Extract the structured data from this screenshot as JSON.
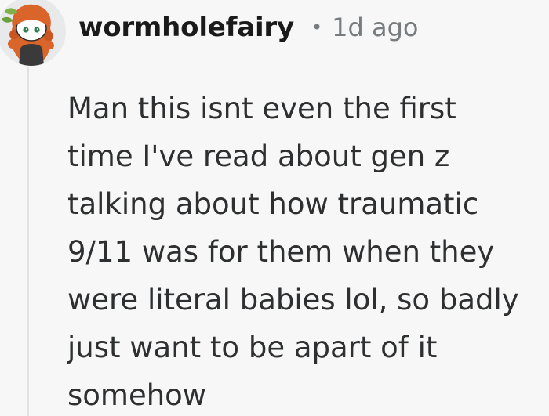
{
  "comment": {
    "author": "wormholefairy",
    "separator": "•",
    "timestamp": "1d ago",
    "avatar_icon": "snoo-avatar-icon",
    "body_lines": [
      "Man this isnt even the first",
      "time I've read about gen z",
      "talking about how traumatic",
      "9/11 was for them when they",
      "were literal babies lol, so badly",
      "just want to be apart of it",
      "somehow"
    ]
  },
  "colors": {
    "background": "#f7f7f7",
    "text": "#2e2f30",
    "meta": "#787c7e",
    "thread_line": "#e2e2e2",
    "avatar_hair": "#d9652a"
  }
}
